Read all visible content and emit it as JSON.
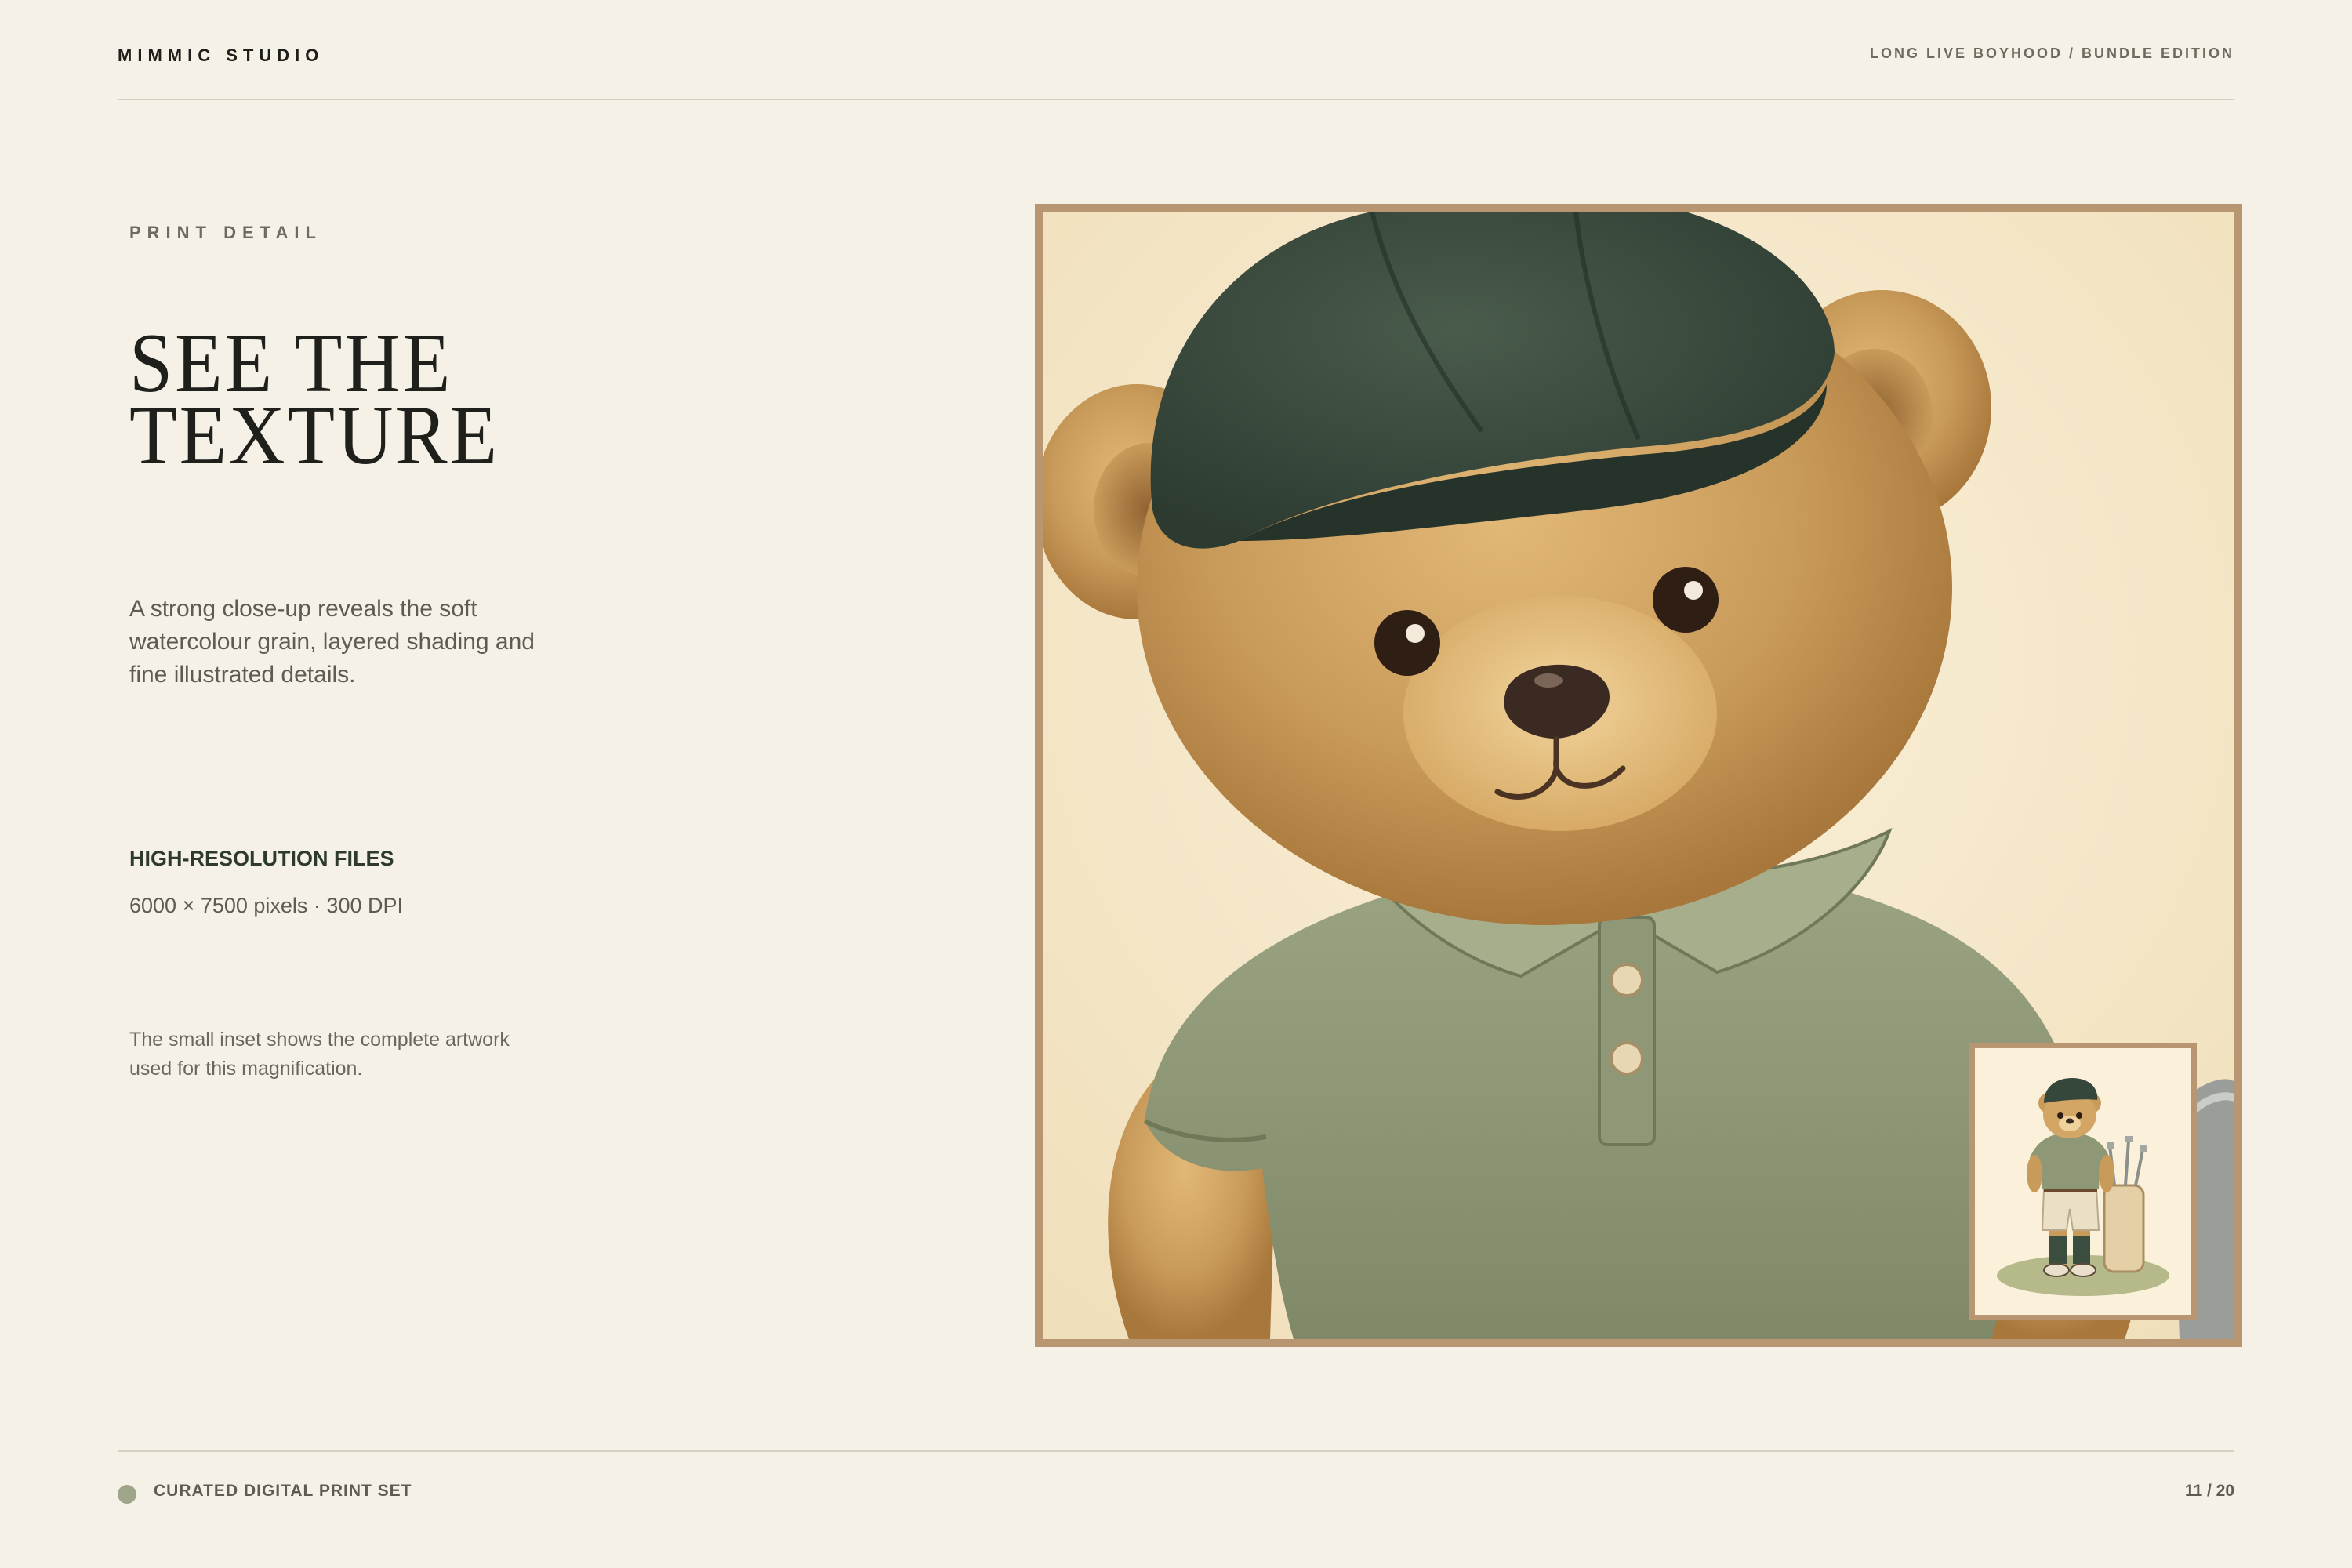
{
  "header": {
    "brand": "MIMMIC STUDIO",
    "edition": "LONG LIVE BOYHOOD / BUNDLE EDITION"
  },
  "content": {
    "eyebrow": "PRINT DETAIL",
    "title_lines": [
      "SEE THE",
      "TEXTURE"
    ],
    "lede": "A strong close-up reveals the soft watercolour grain, layered shading and fine illustrated details.",
    "spec_label": "HIGH-RESOLUTION FILES",
    "spec_value": "6000 × 7500 pixels · 300 DPI",
    "note": "The small inset shows the complete artwork used for this magnification."
  },
  "artwork": {
    "main_image": "teddy-bear-closeup",
    "inset_image": "teddy-bear-golfer-full",
    "colors": {
      "frame": "#b99672",
      "fur": "#c99b5a",
      "cap": "#35463a",
      "shirt": "#8e9876",
      "paper": "#f6e9cc"
    }
  },
  "footer": {
    "label": "CURATED DIGITAL PRINT SET",
    "page": "11 / 20"
  }
}
